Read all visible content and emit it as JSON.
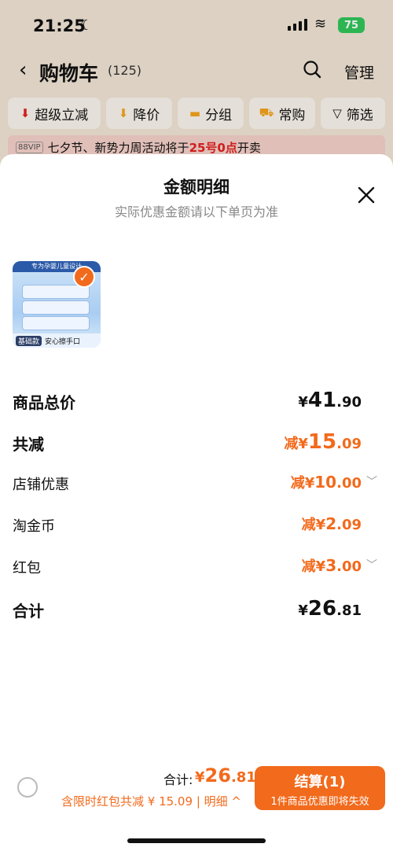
{
  "status": {
    "time": "21:25",
    "battery": "75"
  },
  "nav": {
    "title": "购物车",
    "count": "(125)",
    "manage": "管理"
  },
  "filters": [
    {
      "label": "超级立减",
      "icon": "down-arrow-red-icon"
    },
    {
      "label": "降价",
      "icon": "down-arrow-orange-icon"
    },
    {
      "label": "分组",
      "icon": "folder-icon"
    },
    {
      "label": "常购",
      "icon": "cart-icon"
    },
    {
      "label": "筛选",
      "icon": "funnel-icon"
    }
  ],
  "promo": {
    "vip": "88VIP",
    "text": "七夕节、新势力周活动将于",
    "highlight": "25号0点",
    "suffix": "开卖"
  },
  "sheet": {
    "title": "金额明细",
    "subtitle": "实际优惠金额请以下单页为准",
    "product": {
      "band": "专为孕婴儿童设计",
      "tag": "基础款",
      "caption": "安心擦手口"
    }
  },
  "rows": [
    {
      "label": "商品总价",
      "prefix": "¥",
      "int": "41",
      "dec": ".90"
    },
    {
      "label": "共减",
      "prefix": "减¥",
      "int": "15",
      "dec": ".09"
    },
    {
      "label": "店铺优惠",
      "prefix": "减¥",
      "int": "10",
      "dec": ".00"
    },
    {
      "label": "淘金币",
      "prefix": "减¥",
      "int": "2",
      "dec": ".09"
    },
    {
      "label": "红包",
      "prefix": "减¥",
      "int": "3",
      "dec": ".00"
    },
    {
      "label": "合计",
      "prefix": "¥",
      "int": "26",
      "dec": ".81"
    }
  ],
  "bottom": {
    "total_label": "合计:",
    "total_prefix": "¥",
    "total_int": "26",
    "total_dec": ".81",
    "discount": "含限时红包共减 ¥ 15.09",
    "detail": "| 明细 ^",
    "pay_title": "结算(1)",
    "pay_sub": "1件商品优惠即将失效"
  },
  "colors": {
    "accent": "#f26a1c"
  }
}
